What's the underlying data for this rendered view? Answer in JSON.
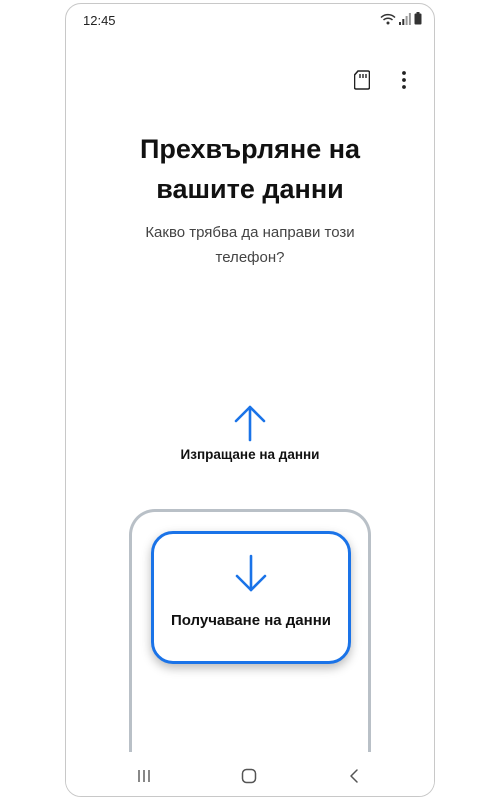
{
  "status_bar": {
    "time": "12:45",
    "icons": [
      "wifi-icon",
      "signal-icon",
      "battery-icon"
    ]
  },
  "toolbar": {
    "icons": [
      "sd-card-icon",
      "more-options-icon"
    ]
  },
  "title_line1": "Прехвърляне на",
  "title_line2": "вашите данни",
  "subtitle_line1": "Какво трябва да направи този",
  "subtitle_line2": "телефон?",
  "options": {
    "send": {
      "label": "Изпращане на данни",
      "icon": "arrow-up-icon"
    },
    "receive": {
      "label": "Получаване на данни",
      "icon": "arrow-down-icon"
    }
  },
  "nav_bar": {
    "icons": [
      "recents-icon",
      "home-icon",
      "back-icon"
    ]
  },
  "colors": {
    "accent": "#1a73e8",
    "frame": "#b9c0c7",
    "text": "#111111"
  }
}
